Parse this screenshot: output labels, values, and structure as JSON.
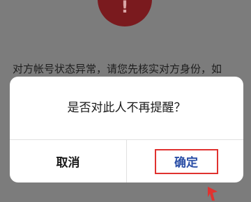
{
  "background": {
    "alert_mark": "!",
    "warning_text": "对方帐号状态异常，请您先核实对方身份，如"
  },
  "dialog": {
    "message": "是否对此人不再提醒？",
    "cancel_label": "取消",
    "confirm_label": "确定"
  },
  "annotation": {
    "highlight_color": "#e0322f",
    "arrow_icon": "red-pointer-arrow-icon"
  },
  "colors": {
    "overlay": "#7c7c7c",
    "alert_circle": "#7a1a1e",
    "confirm_text": "#2a4ea6"
  }
}
